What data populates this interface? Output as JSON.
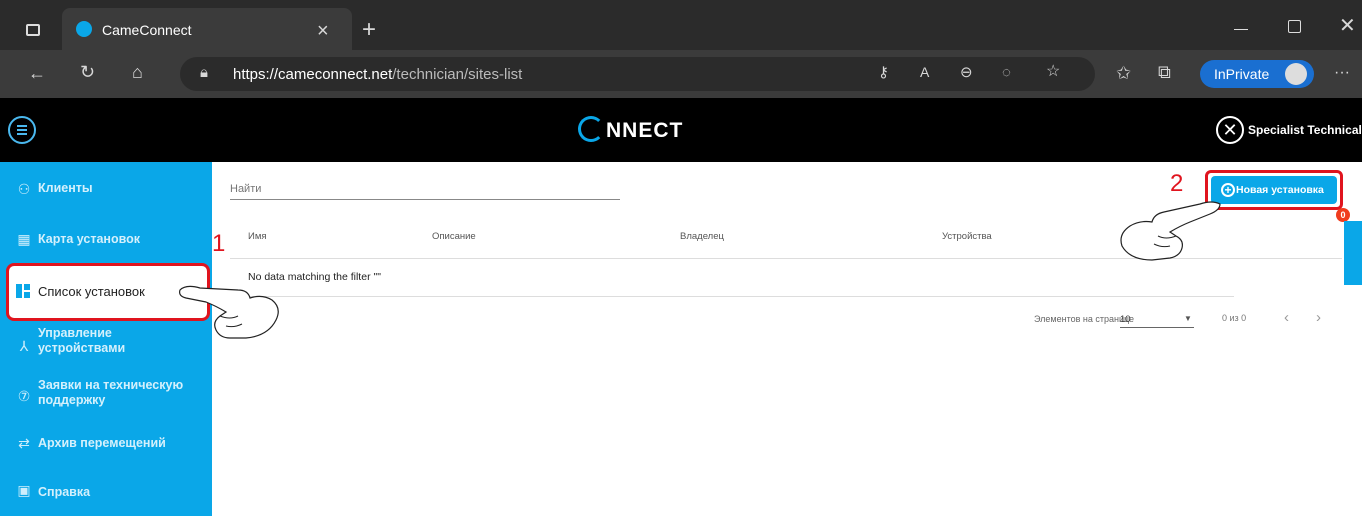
{
  "browser": {
    "tab_title": "CameConnect",
    "new_tab": "+",
    "close_tab": "×",
    "url_host": "https://cameconnect.net",
    "url_path": "/technician/sites-list",
    "inprivate": "InPrivate",
    "more": "···"
  },
  "app": {
    "logo_text": "NNECT",
    "user_name": "Specialist Technical"
  },
  "sidebar": {
    "items": [
      {
        "label": "Клиенты",
        "icon": "users-icon"
      },
      {
        "label": "Карта установок",
        "icon": "map-grid-icon"
      },
      {
        "label": "Список установок",
        "icon": "list-grid-icon"
      },
      {
        "label": "Управление устройствами",
        "icon": "network-icon"
      },
      {
        "label": "Заявки на техническую поддержку",
        "icon": "help-circle-icon"
      },
      {
        "label": "Архив перемещений",
        "icon": "transfer-arrows-icon"
      },
      {
        "label": "Справка",
        "icon": "question-box-icon"
      }
    ]
  },
  "main": {
    "search_placeholder": "Найти",
    "new_button": "Новая установка",
    "columns": [
      "Имя",
      "Описание",
      "Владелец",
      "Устройства"
    ],
    "empty_message": "No data matching the filter \"\"",
    "paginator": {
      "items_per_page_label": "Элементов на странице",
      "page_size": "10",
      "range": "0 из 0"
    },
    "badge_count": "0"
  },
  "annotations": {
    "step1": "1",
    "step2": "2"
  },
  "colors": {
    "sidebar": "#0aa7e8",
    "highlight": "#e0141e",
    "header": "#000000"
  }
}
